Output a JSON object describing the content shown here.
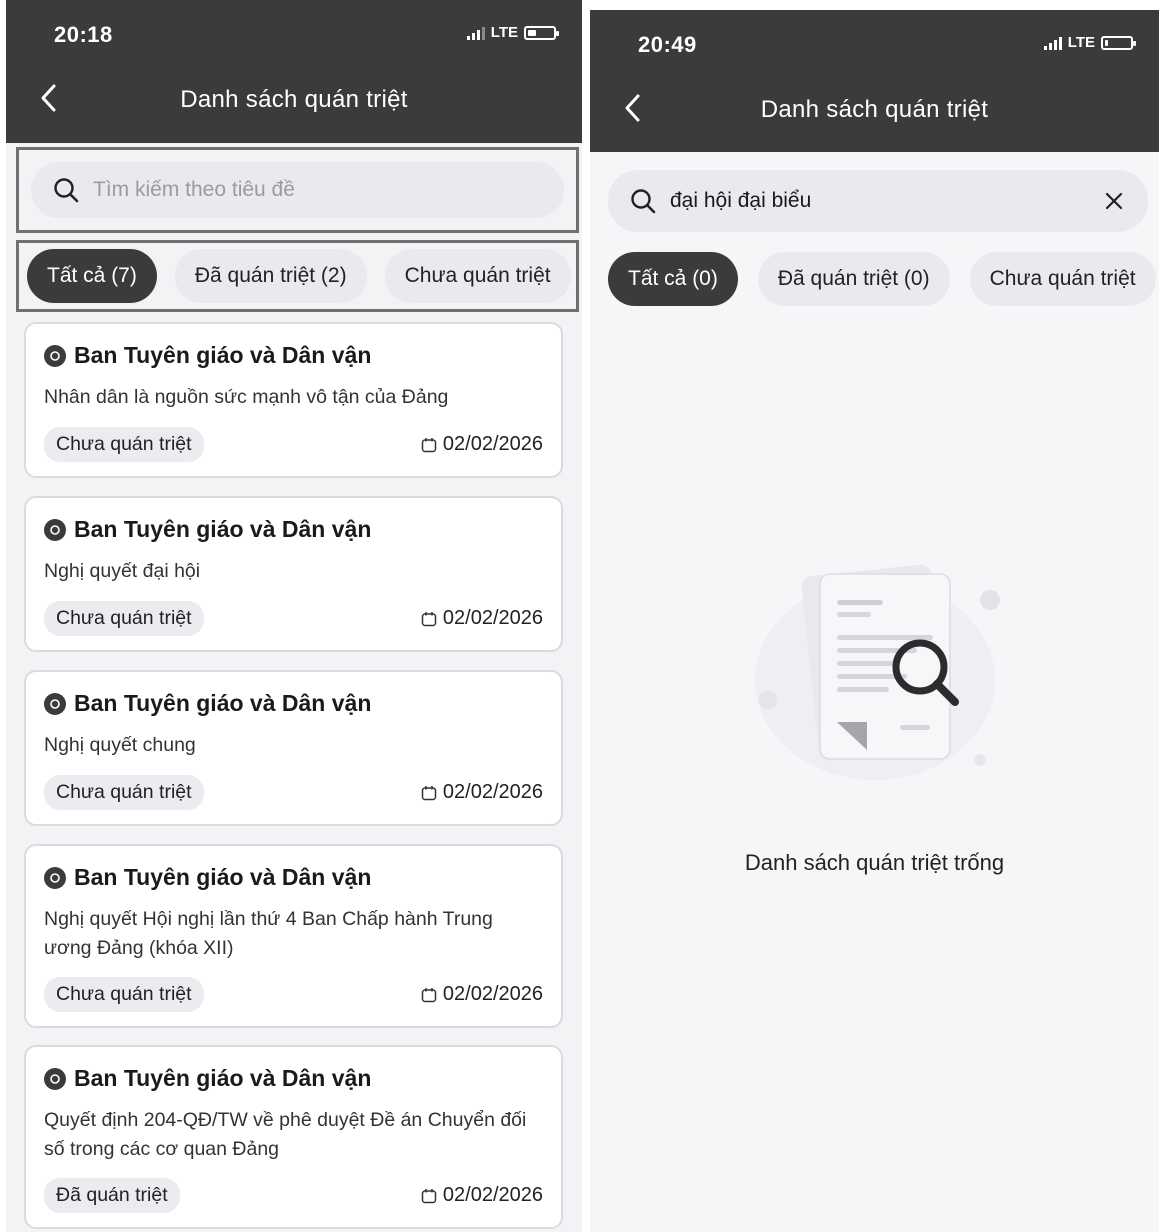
{
  "left_screen": {
    "status_bar": {
      "time": "20:18",
      "network": "LTE",
      "battery_level": 0.3
    },
    "header": {
      "title": "Danh sách quán triệt"
    },
    "search": {
      "placeholder": "Tìm kiếm theo tiêu đề",
      "value": ""
    },
    "tabs": [
      {
        "label": "Tất cả (7)",
        "active": true
      },
      {
        "label": "Đã quán triệt (2)",
        "active": false
      },
      {
        "label": "Chưa quán triệt",
        "active": false
      }
    ],
    "cards": [
      {
        "org": "Ban Tuyên giáo và Dân vận",
        "title": "Nhân dân là nguồn sức mạnh vô tận của Đảng",
        "status": "Chưa quán triệt",
        "date": "02/02/2026"
      },
      {
        "org": "Ban Tuyên giáo và Dân vận",
        "title": "Nghị quyết đại hội",
        "status": "Chưa quán triệt",
        "date": "02/02/2026"
      },
      {
        "org": "Ban Tuyên giáo và Dân vận",
        "title": "Nghị quyết chung",
        "status": "Chưa quán triệt",
        "date": "02/02/2026"
      },
      {
        "org": "Ban Tuyên giáo và Dân vận",
        "title": "Nghị quyết Hội nghị lần thứ 4 Ban Chấp hành Trung ương Đảng (khóa XII)",
        "status": "Chưa quán triệt",
        "date": "02/02/2026"
      },
      {
        "org": "Ban Tuyên giáo và Dân vận",
        "title": "Quyết định 204-QĐ/TW về phê duyệt Đề án Chuyển đối số trong các cơ quan Đảng",
        "status": "Đã quán triệt",
        "date": "02/02/2026"
      }
    ]
  },
  "right_screen": {
    "status_bar": {
      "time": "20:49",
      "network": "LTE",
      "battery_level": 0.1
    },
    "header": {
      "title": "Danh sách quán triệt"
    },
    "search": {
      "value": "đại hội đại biểu"
    },
    "tabs": [
      {
        "label": "Tất cả (0)",
        "active": true
      },
      {
        "label": "Đã quán triệt (0)",
        "active": false
      },
      {
        "label": "Chưa quán triệt",
        "active": false
      }
    ],
    "empty_state": {
      "message": "Danh sách quán triệt trống",
      "illustration": "document-search-illustration"
    }
  },
  "icons": {
    "back": "chevron-left-icon",
    "search": "search-icon",
    "clear": "close-icon",
    "calendar": "calendar-icon",
    "org": "org-logo-icon"
  },
  "colors": {
    "header_bg": "#3a3b3d",
    "active_tab_bg": "#3a3b3d",
    "tab_bg": "#e9e9ee",
    "card_bg": "#ffffff",
    "badge_bg": "#ececf0"
  }
}
